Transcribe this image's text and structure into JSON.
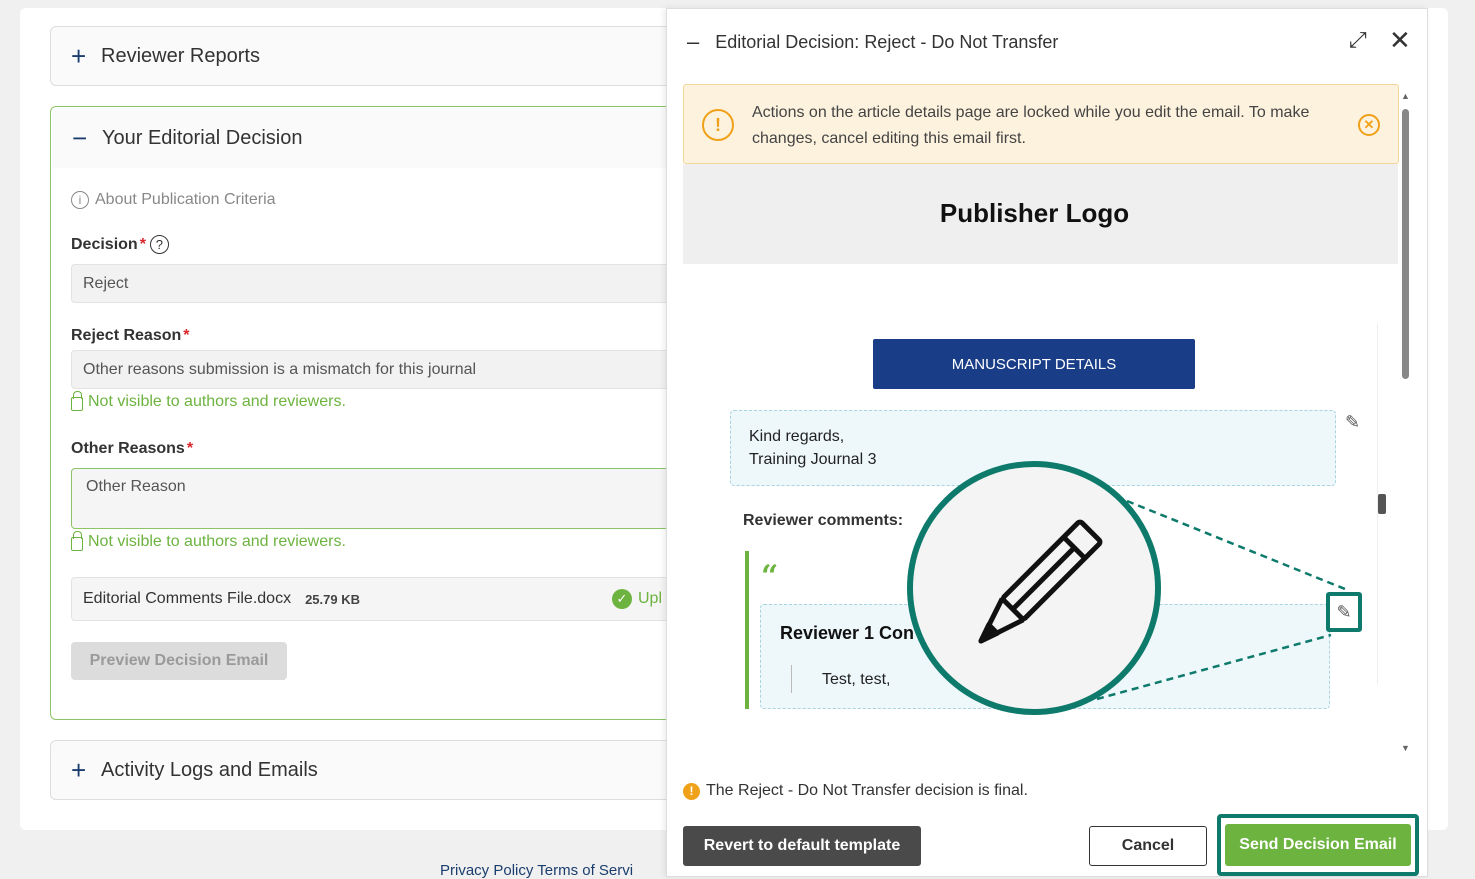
{
  "left_panel": {
    "reviewer_reports": {
      "symbol": "+",
      "label": "Reviewer Reports"
    },
    "editorial_decision": {
      "symbol": "−",
      "label": "Your Editorial Decision",
      "about_link": "About Publication Criteria",
      "decision_label": "Decision",
      "decision_value": "Reject",
      "reject_reason_label": "Reject Reason",
      "reject_reason_value": "Other reasons submission is a mismatch for this journal",
      "visibility_note": "Not visible to authors and reviewers.",
      "other_reasons_label": "Other Reasons",
      "other_reasons_placeholder": "Other Reason",
      "visibility_note_2": "Not visible to authors and reviewers.",
      "file_name": "Editorial Comments File.docx",
      "file_size": "25.79 KB",
      "upload_status": "Upl",
      "preview_button": "Preview Decision Email"
    },
    "activity_logs": {
      "symbol": "+",
      "label": "Activity Logs and Emails"
    },
    "footer_links": "Privacy Policy  Terms of Servi"
  },
  "modal": {
    "title": "Editorial Decision: Reject - Do Not Transfer",
    "warning": "Actions on the article details page are locked while you edit the email. To make changes, cancel editing this email first.",
    "publisher_logo": "Publisher Logo",
    "manuscript_button": "MANUSCRIPT DETAILS",
    "regards_line1": "Kind regards,",
    "regards_line2": "Training Journal 3",
    "reviewer_comments_label": "Reviewer comments:",
    "quote_mark": "“",
    "reviewer_title": "Reviewer 1 Con",
    "reviewer_text": "Test, test,",
    "final_note": "The Reject - Do Not Transfer decision is final.",
    "revert_button": "Revert to default template",
    "cancel_button": "Cancel",
    "send_button": "Send Decision Email"
  },
  "colors": {
    "accent_green": "#6db33f",
    "navy": "#1a3d88",
    "highlight_teal": "#0d7a6b",
    "warning_orange": "#f0a11a"
  }
}
